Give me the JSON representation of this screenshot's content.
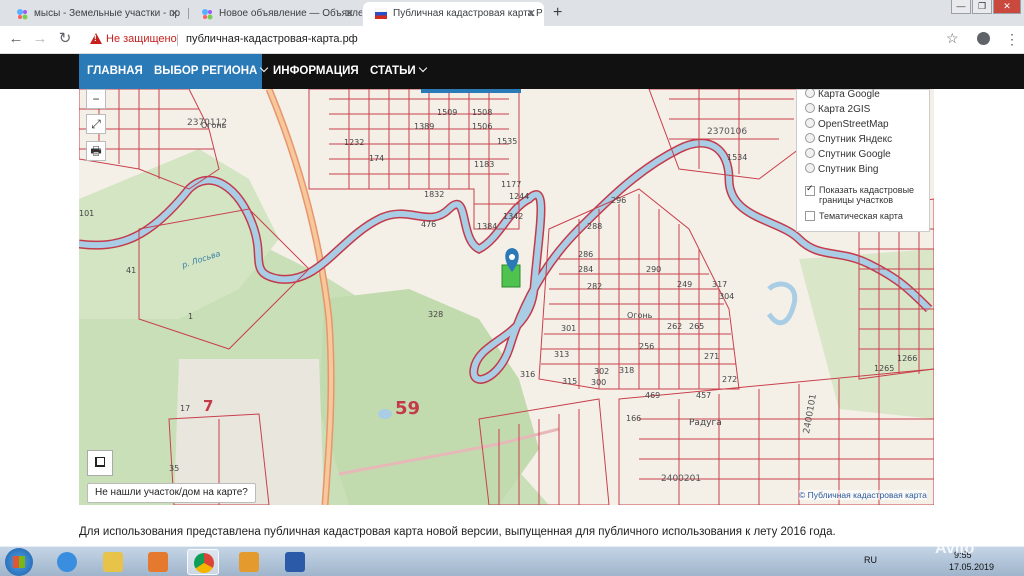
{
  "browser": {
    "tabs": [
      {
        "title": "мысы - Земельные участки - пр",
        "active": false
      },
      {
        "title": "Новое объявление — Объявлен",
        "active": false
      },
      {
        "title": "Публичная кадастровая карта Р",
        "active": true
      }
    ],
    "new_tab": "+",
    "window_buttons": [
      "—",
      "❐",
      "✕"
    ],
    "security_label": "Не защищено",
    "url": "публичная-кадастровая-карта.рф",
    "icons": [
      "back-icon",
      "forward-icon",
      "reload-icon",
      "warning-icon",
      "star-icon",
      "account-icon",
      "menu-icon"
    ]
  },
  "site_nav": {
    "items": [
      {
        "label": "ГЛАВНАЯ",
        "dropdown": false
      },
      {
        "label": "ВЫБОР РЕГИОНА",
        "dropdown": true
      },
      {
        "label": "ИНФОРМАЦИЯ",
        "dropdown": false
      },
      {
        "label": "СТАТЬИ",
        "dropdown": true
      }
    ],
    "accent": "#2a7ab8"
  },
  "map": {
    "zoom_out": "−",
    "fullscreen_icon": "⤢",
    "print_icon": "🖶",
    "layers": [
      {
        "label": "Карта Google"
      },
      {
        "label": "Карта 2GIS"
      },
      {
        "label": "OpenStreetMap"
      },
      {
        "label": "Спутник Яндекс"
      },
      {
        "label": "Спутник Google"
      },
      {
        "label": "Спутник Bing"
      }
    ],
    "cadastral_toggle": {
      "label_1": "Показать кадастровые",
      "label_2": "границы участков",
      "checked": true
    },
    "thematic_toggle": {
      "label": "Тематическая карта",
      "checked": false
    },
    "not_found_button": "Не нашли участок/дом на карте?",
    "attribution": "© Публичная кадастровая карта",
    "labels": {
      "big59": "59",
      "big7": "7",
      "river": "р. Лосьва",
      "village1": "Огонь",
      "village2": "Огонь",
      "village3": "Радуга",
      "q1": "2370112",
      "q2": "2370106",
      "q3": "2400201",
      "q4": "2400101",
      "n1534": "1534",
      "n328": "328",
      "n41": "41",
      "n1": "1",
      "n17": "17",
      "n35": "35",
      "n101": "101",
      "n174": "174",
      "n166": "166",
      "n469": "469",
      "n457": "457",
      "n1266": "1266",
      "n1265": "1265",
      "n1232": "1232",
      "n1389": "1389",
      "n1509": "1509",
      "n1508": "1508",
      "n1506": "1506",
      "n1535": "1535",
      "n1183": "1183",
      "n1244": "1244",
      "n1177": "1177",
      "n1342": "1342",
      "n1384": "1384",
      "n1832": "1832",
      "n476": "476",
      "n296": "296",
      "n288": "288",
      "n286": "286",
      "n284": "284",
      "n282": "282",
      "n290": "290",
      "n249": "249",
      "n317": "317",
      "n304": "304",
      "n301": "301",
      "n313": "313",
      "n315": "315",
      "n302": "302",
      "n300": "300",
      "n316": "316",
      "n262": "262",
      "n265": "265",
      "n256": "256",
      "n318": "318",
      "n271": "271",
      "n272": "272"
    }
  },
  "description": "Для использования представлена публичная кадастровая карта новой версии, выпущенная для публичного использования к лету 2016 года.",
  "taskbar": {
    "apps": [
      "start-icon",
      "ie-icon",
      "explorer-icon",
      "media-icon",
      "chrome-icon",
      "outlook-icon",
      "window-app-icon"
    ],
    "lang": "RU",
    "time": "9:55",
    "date": "17.05.2019"
  },
  "watermark": "Avito"
}
